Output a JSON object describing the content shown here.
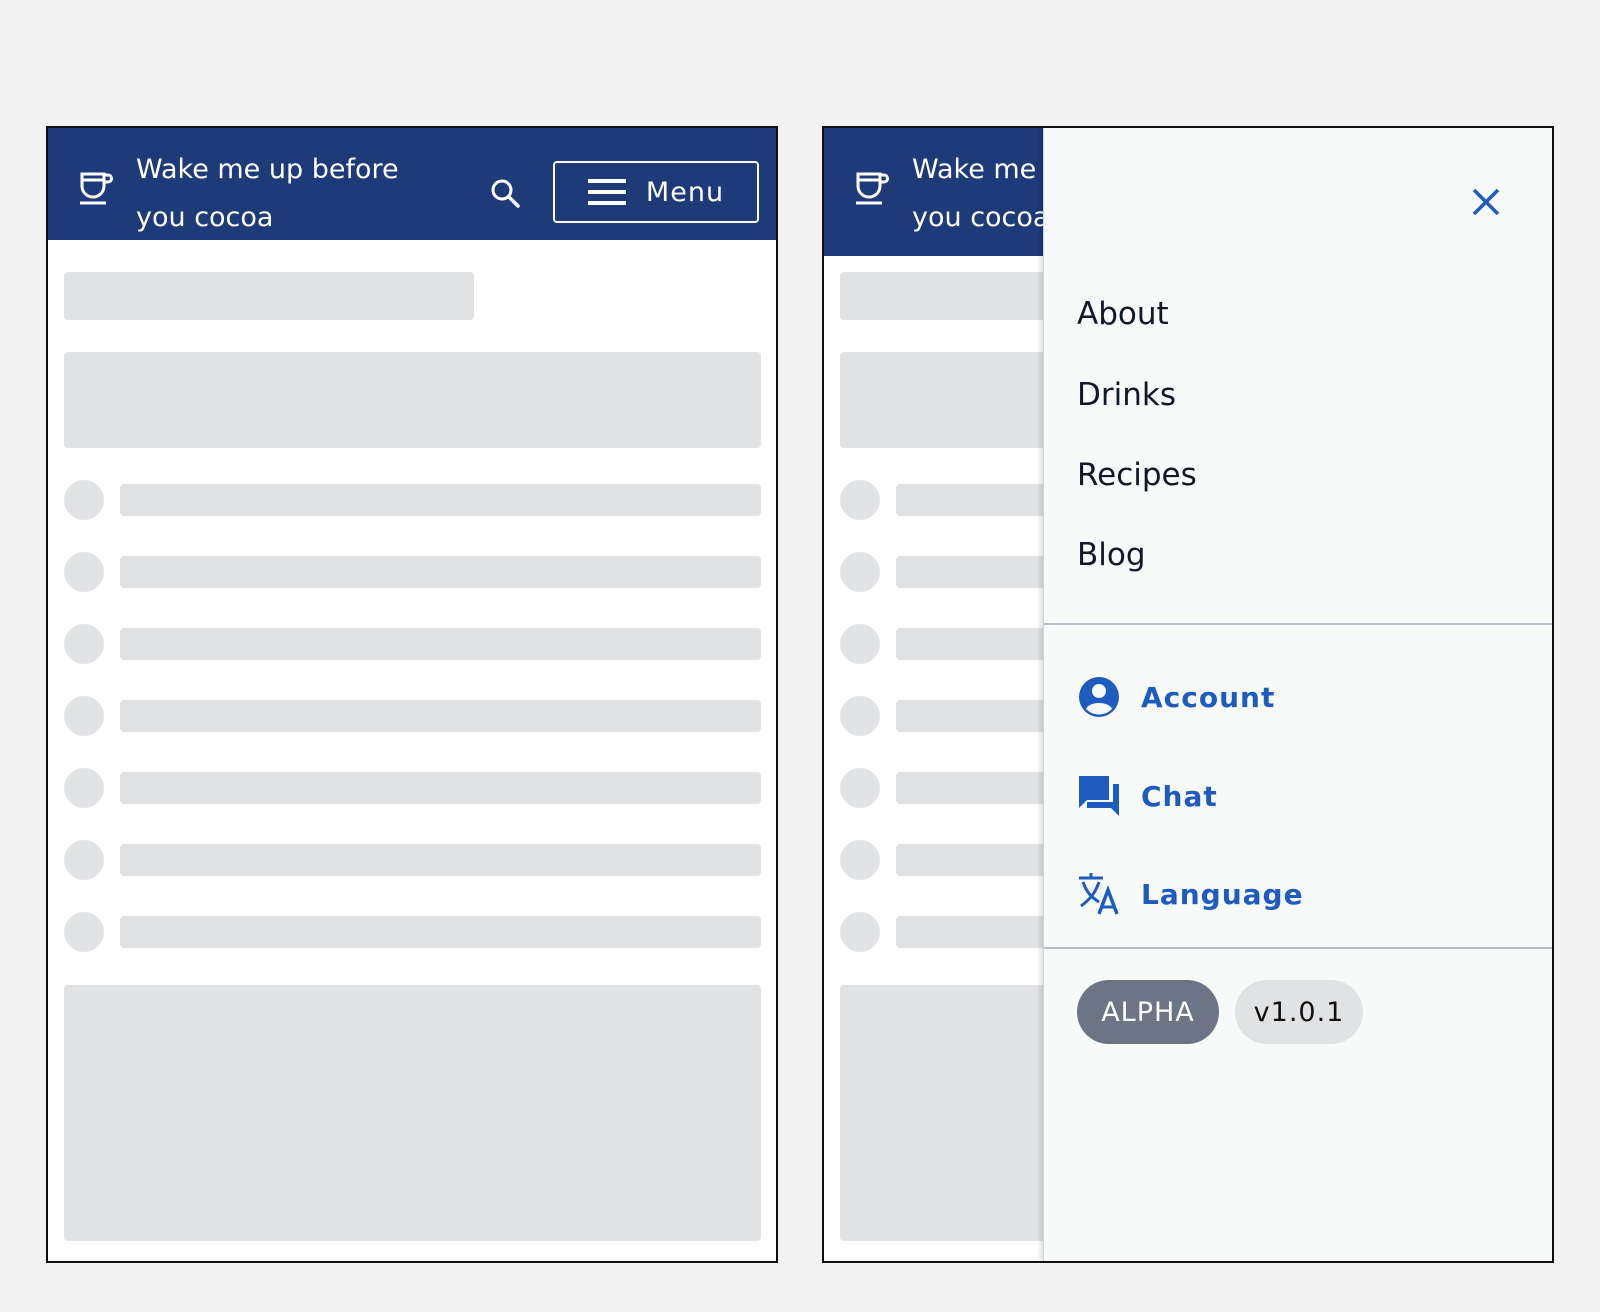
{
  "site": {
    "title": "Wake me up before you cocoa",
    "logo_icon": "coffee-cup-icon"
  },
  "header": {
    "search_icon": "search-icon",
    "menu_label": "Menu",
    "menu_icon": "hamburger-icon"
  },
  "skeleton": {
    "list_rows": 7
  },
  "drawer": {
    "close_icon": "close-icon",
    "primary_links": [
      {
        "label": "About"
      },
      {
        "label": "Drinks"
      },
      {
        "label": "Recipes"
      },
      {
        "label": "Blog"
      }
    ],
    "secondary_links": [
      {
        "label": "Account",
        "icon": "account-circle-icon"
      },
      {
        "label": "Chat",
        "icon": "chat-bubbles-icon"
      },
      {
        "label": "Language",
        "icon": "translate-icon"
      }
    ],
    "badges": {
      "stage": "ALPHA",
      "version": "v1.0.1"
    }
  },
  "colors": {
    "header_bg": "#1e3a78",
    "accent": "#1d5bbf",
    "skeleton": "#e1e2e4",
    "drawer_bg": "#f8f9f9",
    "alpha_badge": "#6b7585"
  }
}
